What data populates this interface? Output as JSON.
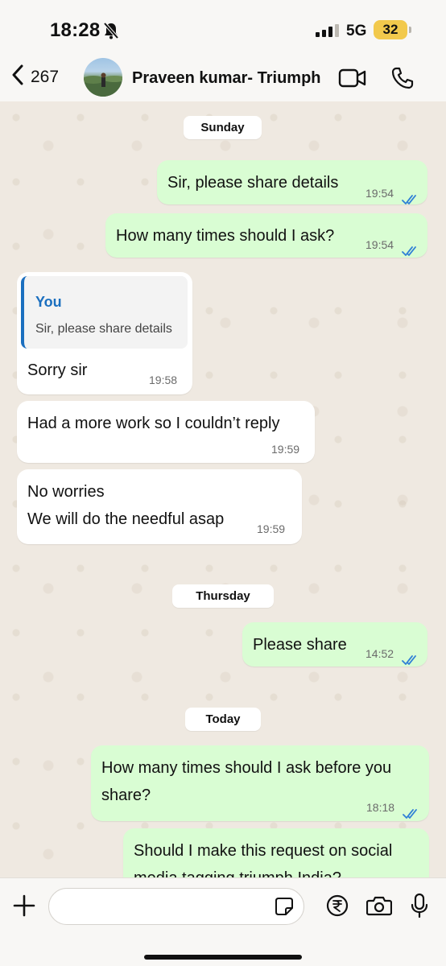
{
  "status_bar": {
    "time": "18:28",
    "network": "5G",
    "battery": "32",
    "mute_icon": "bell-slash-icon",
    "signal_icon": "signal-bars-icon"
  },
  "header": {
    "back_count": "267",
    "contact_name": "Praveen kumar- Triumph",
    "icons": [
      "chevron-left-icon",
      "video-call-icon",
      "phone-icon"
    ]
  },
  "date_labels": {
    "sunday": "Sunday",
    "thursday": "Thursday",
    "today": "Today"
  },
  "messages": [
    {
      "dir": "out",
      "text": "Sir, please share details",
      "time": "19:54",
      "status": "read"
    },
    {
      "dir": "out",
      "text": "How many times should I ask?",
      "time": "19:54",
      "status": "read"
    },
    {
      "dir": "in",
      "quote_author": "You",
      "quote_text": "Sir, please share details",
      "text": "Sorry sir",
      "time": "19:58"
    },
    {
      "dir": "in",
      "text": "Had a more work so I couldn’t reply",
      "time": "19:59"
    },
    {
      "dir": "in",
      "text": "No worries\nWe will do the needful asap",
      "time": "19:59"
    },
    {
      "dir": "out",
      "text": "Please share",
      "time": "14:52",
      "status": "read"
    },
    {
      "dir": "out",
      "text": "How many times should I ask before you\nshare?",
      "time": "18:18",
      "status": "read"
    },
    {
      "dir": "out",
      "text": "Should I make this request on social\nmedia tagging triumph India?",
      "time": "",
      "status": ""
    }
  ],
  "composer": {
    "placeholder": "",
    "icons": [
      "plus-icon",
      "sticker-icon",
      "rupee-icon",
      "camera-icon",
      "microphone-icon"
    ]
  },
  "colors": {
    "outgoing_bubble": "#d9fdd3",
    "incoming_bubble": "#ffffff",
    "read_tick": "#2f7fd6",
    "quote_accent": "#1b6fbf",
    "battery": "#f2c94c"
  }
}
